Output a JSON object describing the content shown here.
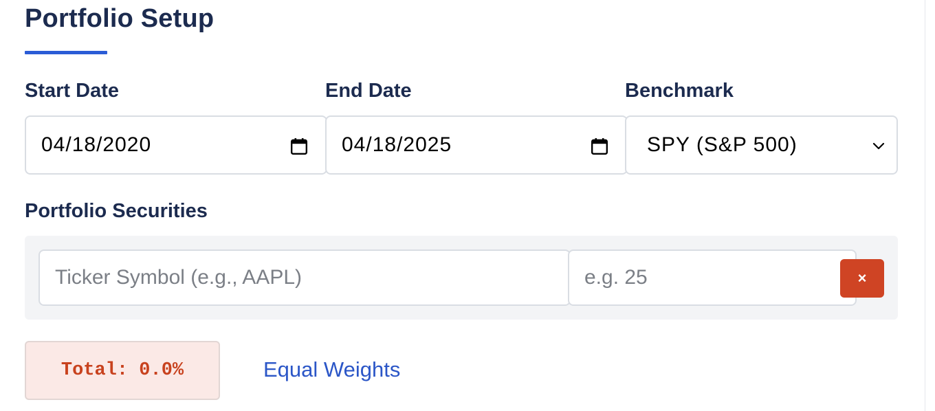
{
  "title": "Portfolio Setup",
  "fields": {
    "start_date": {
      "label": "Start Date",
      "value": "04/18/2020",
      "icon": "calendar-icon"
    },
    "end_date": {
      "label": "End Date",
      "value": "04/18/2025",
      "icon": "calendar-icon"
    },
    "benchmark": {
      "label": "Benchmark",
      "value": "SPY (S&P 500)",
      "icon": "chevron-down-icon"
    }
  },
  "securities": {
    "label": "Portfolio Securities",
    "ticker_placeholder": "Ticker Symbol (e.g., AAPL)",
    "weight_placeholder": "e.g. 25",
    "remove_label": "×"
  },
  "total": {
    "text": "Total: 0.0%"
  },
  "equal_weights_label": "Equal Weights",
  "colors": {
    "accent": "#2b5cd6",
    "danger": "#cf4424",
    "heading": "#1c2b4f",
    "link": "#2b56c7"
  }
}
